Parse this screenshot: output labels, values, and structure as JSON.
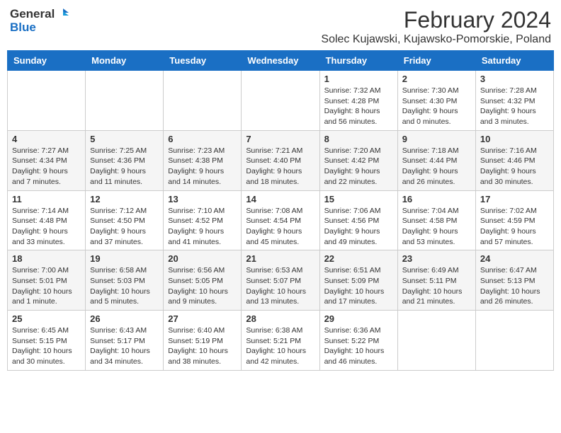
{
  "header": {
    "logo_general": "General",
    "logo_blue": "Blue",
    "month_title": "February 2024",
    "location": "Solec Kujawski, Kujawsko-Pomorskie, Poland"
  },
  "days_of_week": [
    "Sunday",
    "Monday",
    "Tuesday",
    "Wednesday",
    "Thursday",
    "Friday",
    "Saturday"
  ],
  "weeks": [
    {
      "days": [
        {
          "num": "",
          "info": ""
        },
        {
          "num": "",
          "info": ""
        },
        {
          "num": "",
          "info": ""
        },
        {
          "num": "",
          "info": ""
        },
        {
          "num": "1",
          "info": "Sunrise: 7:32 AM\nSunset: 4:28 PM\nDaylight: 8 hours\nand 56 minutes."
        },
        {
          "num": "2",
          "info": "Sunrise: 7:30 AM\nSunset: 4:30 PM\nDaylight: 9 hours\nand 0 minutes."
        },
        {
          "num": "3",
          "info": "Sunrise: 7:28 AM\nSunset: 4:32 PM\nDaylight: 9 hours\nand 3 minutes."
        }
      ]
    },
    {
      "days": [
        {
          "num": "4",
          "info": "Sunrise: 7:27 AM\nSunset: 4:34 PM\nDaylight: 9 hours\nand 7 minutes."
        },
        {
          "num": "5",
          "info": "Sunrise: 7:25 AM\nSunset: 4:36 PM\nDaylight: 9 hours\nand 11 minutes."
        },
        {
          "num": "6",
          "info": "Sunrise: 7:23 AM\nSunset: 4:38 PM\nDaylight: 9 hours\nand 14 minutes."
        },
        {
          "num": "7",
          "info": "Sunrise: 7:21 AM\nSunset: 4:40 PM\nDaylight: 9 hours\nand 18 minutes."
        },
        {
          "num": "8",
          "info": "Sunrise: 7:20 AM\nSunset: 4:42 PM\nDaylight: 9 hours\nand 22 minutes."
        },
        {
          "num": "9",
          "info": "Sunrise: 7:18 AM\nSunset: 4:44 PM\nDaylight: 9 hours\nand 26 minutes."
        },
        {
          "num": "10",
          "info": "Sunrise: 7:16 AM\nSunset: 4:46 PM\nDaylight: 9 hours\nand 30 minutes."
        }
      ]
    },
    {
      "days": [
        {
          "num": "11",
          "info": "Sunrise: 7:14 AM\nSunset: 4:48 PM\nDaylight: 9 hours\nand 33 minutes."
        },
        {
          "num": "12",
          "info": "Sunrise: 7:12 AM\nSunset: 4:50 PM\nDaylight: 9 hours\nand 37 minutes."
        },
        {
          "num": "13",
          "info": "Sunrise: 7:10 AM\nSunset: 4:52 PM\nDaylight: 9 hours\nand 41 minutes."
        },
        {
          "num": "14",
          "info": "Sunrise: 7:08 AM\nSunset: 4:54 PM\nDaylight: 9 hours\nand 45 minutes."
        },
        {
          "num": "15",
          "info": "Sunrise: 7:06 AM\nSunset: 4:56 PM\nDaylight: 9 hours\nand 49 minutes."
        },
        {
          "num": "16",
          "info": "Sunrise: 7:04 AM\nSunset: 4:58 PM\nDaylight: 9 hours\nand 53 minutes."
        },
        {
          "num": "17",
          "info": "Sunrise: 7:02 AM\nSunset: 4:59 PM\nDaylight: 9 hours\nand 57 minutes."
        }
      ]
    },
    {
      "days": [
        {
          "num": "18",
          "info": "Sunrise: 7:00 AM\nSunset: 5:01 PM\nDaylight: 10 hours\nand 1 minute."
        },
        {
          "num": "19",
          "info": "Sunrise: 6:58 AM\nSunset: 5:03 PM\nDaylight: 10 hours\nand 5 minutes."
        },
        {
          "num": "20",
          "info": "Sunrise: 6:56 AM\nSunset: 5:05 PM\nDaylight: 10 hours\nand 9 minutes."
        },
        {
          "num": "21",
          "info": "Sunrise: 6:53 AM\nSunset: 5:07 PM\nDaylight: 10 hours\nand 13 minutes."
        },
        {
          "num": "22",
          "info": "Sunrise: 6:51 AM\nSunset: 5:09 PM\nDaylight: 10 hours\nand 17 minutes."
        },
        {
          "num": "23",
          "info": "Sunrise: 6:49 AM\nSunset: 5:11 PM\nDaylight: 10 hours\nand 21 minutes."
        },
        {
          "num": "24",
          "info": "Sunrise: 6:47 AM\nSunset: 5:13 PM\nDaylight: 10 hours\nand 26 minutes."
        }
      ]
    },
    {
      "days": [
        {
          "num": "25",
          "info": "Sunrise: 6:45 AM\nSunset: 5:15 PM\nDaylight: 10 hours\nand 30 minutes."
        },
        {
          "num": "26",
          "info": "Sunrise: 6:43 AM\nSunset: 5:17 PM\nDaylight: 10 hours\nand 34 minutes."
        },
        {
          "num": "27",
          "info": "Sunrise: 6:40 AM\nSunset: 5:19 PM\nDaylight: 10 hours\nand 38 minutes."
        },
        {
          "num": "28",
          "info": "Sunrise: 6:38 AM\nSunset: 5:21 PM\nDaylight: 10 hours\nand 42 minutes."
        },
        {
          "num": "29",
          "info": "Sunrise: 6:36 AM\nSunset: 5:22 PM\nDaylight: 10 hours\nand 46 minutes."
        },
        {
          "num": "",
          "info": ""
        },
        {
          "num": "",
          "info": ""
        }
      ]
    }
  ]
}
